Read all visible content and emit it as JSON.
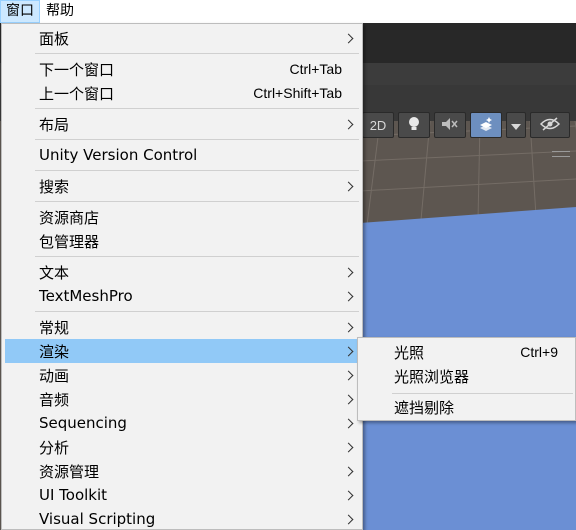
{
  "menubar": {
    "items": [
      {
        "label": "窗口"
      },
      {
        "label": "帮助"
      }
    ]
  },
  "window_menu": {
    "items": [
      {
        "label": "面板",
        "shortcut": "",
        "submenu": true
      },
      {
        "label": "下一个窗口",
        "shortcut": "Ctrl+Tab",
        "submenu": false
      },
      {
        "label": "上一个窗口",
        "shortcut": "Ctrl+Shift+Tab",
        "submenu": false
      },
      {
        "label": "布局",
        "shortcut": "",
        "submenu": true
      },
      {
        "label": "Unity Version Control",
        "shortcut": "",
        "submenu": false
      },
      {
        "label": "搜索",
        "shortcut": "",
        "submenu": true
      },
      {
        "label": "资源商店",
        "shortcut": "",
        "submenu": false
      },
      {
        "label": "包管理器",
        "shortcut": "",
        "submenu": false
      },
      {
        "label": "文本",
        "shortcut": "",
        "submenu": true
      },
      {
        "label": "TextMeshPro",
        "shortcut": "",
        "submenu": true
      },
      {
        "label": "常规",
        "shortcut": "",
        "submenu": true
      },
      {
        "label": "渲染",
        "shortcut": "",
        "submenu": true,
        "highlighted": true
      },
      {
        "label": "动画",
        "shortcut": "",
        "submenu": true
      },
      {
        "label": "音频",
        "shortcut": "",
        "submenu": true
      },
      {
        "label": "Sequencing",
        "shortcut": "",
        "submenu": true
      },
      {
        "label": "分析",
        "shortcut": "",
        "submenu": true
      },
      {
        "label": "资源管理",
        "shortcut": "",
        "submenu": true
      },
      {
        "label": "UI Toolkit",
        "shortcut": "",
        "submenu": true
      },
      {
        "label": "Visual Scripting",
        "shortcut": "",
        "submenu": true
      }
    ]
  },
  "render_submenu": {
    "items": [
      {
        "label": "光照",
        "shortcut": "Ctrl+9"
      },
      {
        "label": "光照浏览器",
        "shortcut": ""
      },
      {
        "label": "遮挡剔除",
        "shortcut": ""
      }
    ]
  },
  "scene_toolbar": {
    "mode_2d": "2D",
    "icons": [
      "lightbulb-icon",
      "audio-mute-icon",
      "effects-icon",
      "dropdown-arrow-icon",
      "visibility-hidden-icon"
    ]
  },
  "colors": {
    "menu_bg": "#f2f2f2",
    "highlight": "#91c9f7",
    "menubar_active": "#cce8ff",
    "scene_grid": "#5d5650",
    "scene_plane": "#6b8fd4",
    "toolbar_active": "#6d8fbf"
  }
}
